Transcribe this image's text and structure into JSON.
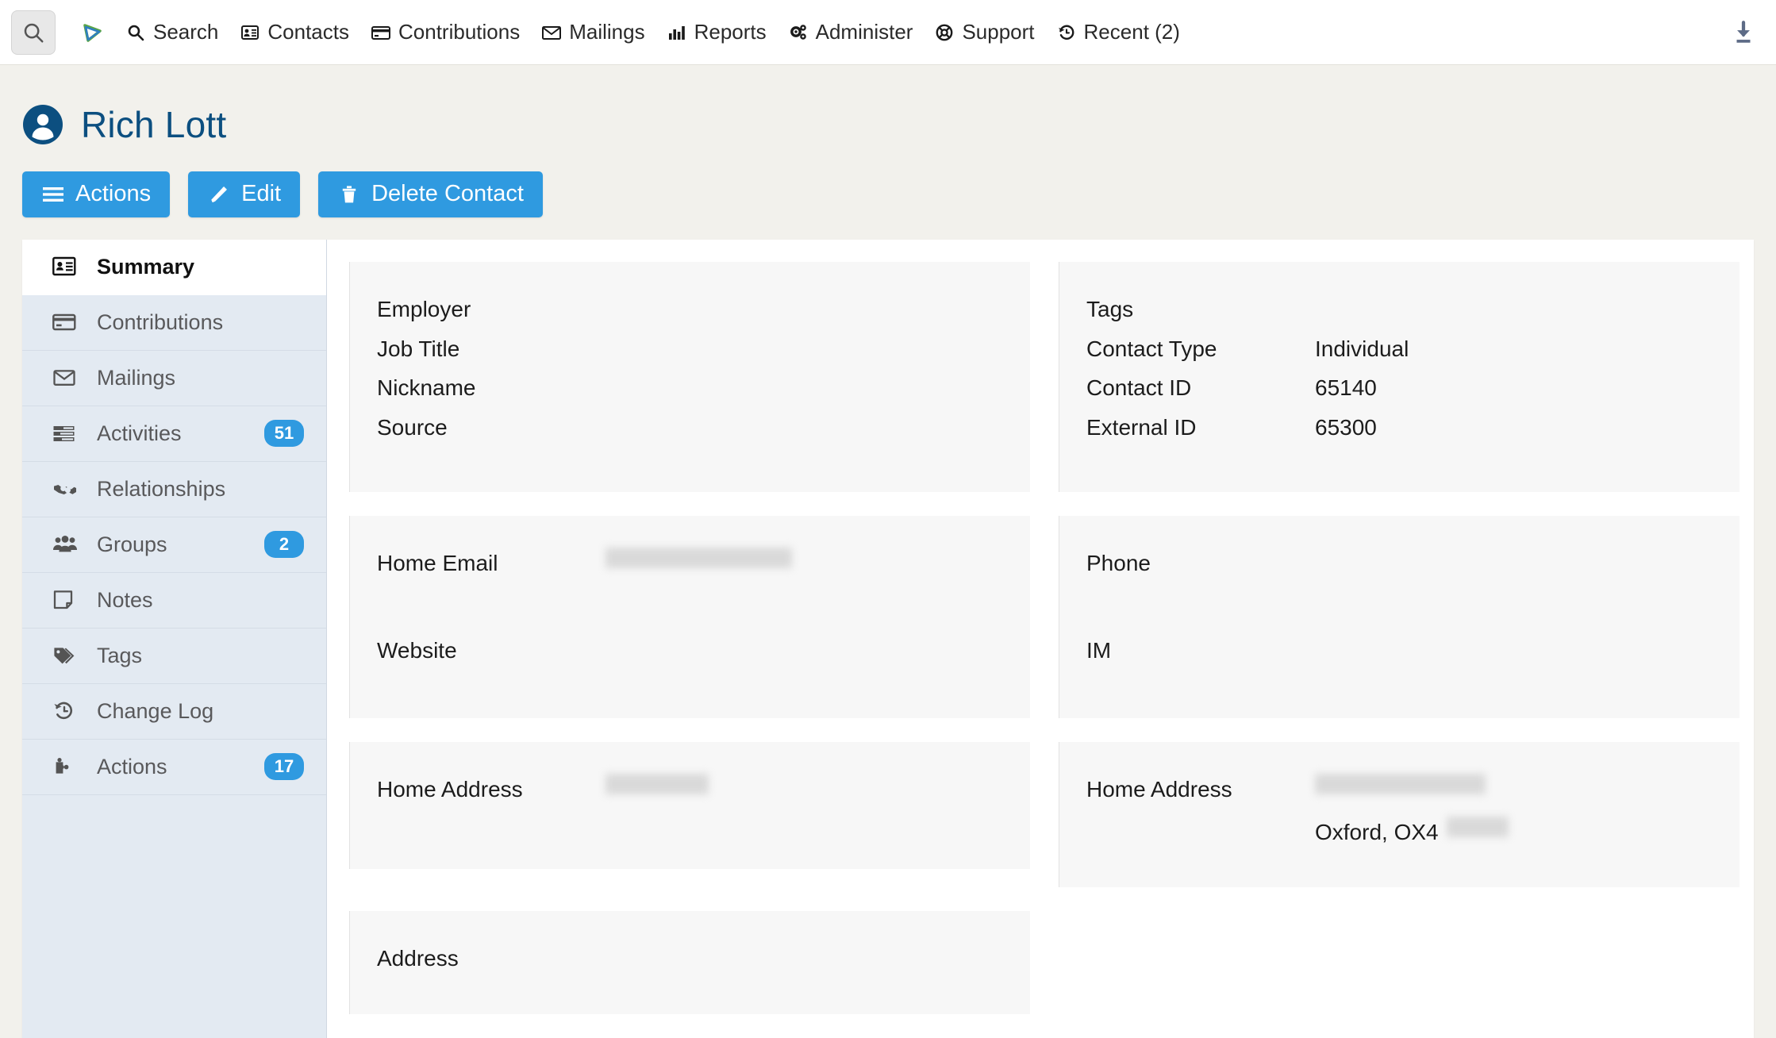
{
  "topnav": {
    "search_button_icon": "search-icon",
    "logo_icon": "civicrm-logo-icon",
    "download_icon": "download-icon",
    "items": [
      {
        "label": "Search",
        "icon": "search-icon"
      },
      {
        "label": "Contacts",
        "icon": "contact-card-icon"
      },
      {
        "label": "Contributions",
        "icon": "credit-card-icon"
      },
      {
        "label": "Mailings",
        "icon": "envelope-icon"
      },
      {
        "label": "Reports",
        "icon": "bar-chart-icon"
      },
      {
        "label": "Administer",
        "icon": "gears-icon"
      },
      {
        "label": "Support",
        "icon": "life-ring-icon"
      },
      {
        "label": "Recent (2)",
        "icon": "history-icon"
      }
    ]
  },
  "contact": {
    "name": "Rich Lott",
    "avatar_icon": "user-circle-icon"
  },
  "actions_bar": [
    {
      "label": "Actions",
      "icon": "hamburger-icon"
    },
    {
      "label": "Edit",
      "icon": "pencil-icon"
    },
    {
      "label": "Delete Contact",
      "icon": "trash-icon"
    }
  ],
  "tabs": [
    {
      "label": "Summary",
      "icon": "contact-card-icon",
      "badge": "",
      "active": true
    },
    {
      "label": "Contributions",
      "icon": "credit-card-icon",
      "badge": "",
      "active": false
    },
    {
      "label": "Mailings",
      "icon": "envelope-icon",
      "badge": "",
      "active": false
    },
    {
      "label": "Activities",
      "icon": "list-icon",
      "badge": "51",
      "active": false
    },
    {
      "label": "Relationships",
      "icon": "handshake-icon",
      "badge": "",
      "active": false
    },
    {
      "label": "Groups",
      "icon": "users-icon",
      "badge": "2",
      "active": false
    },
    {
      "label": "Notes",
      "icon": "note-icon",
      "badge": "",
      "active": false
    },
    {
      "label": "Tags",
      "icon": "tag-icon",
      "badge": "",
      "active": false
    },
    {
      "label": "Change Log",
      "icon": "history-icon",
      "badge": "",
      "active": false
    },
    {
      "label": "Actions",
      "icon": "puzzle-icon",
      "badge": "17",
      "active": false
    }
  ],
  "summary": {
    "employment": {
      "employer_label": "Employer",
      "employer_value": "",
      "job_title_label": "Job Title",
      "job_title_value": "",
      "nickname_label": "Nickname",
      "nickname_value": "",
      "source_label": "Source",
      "source_value": ""
    },
    "contact_meta": {
      "tags_label": "Tags",
      "tags_value": "",
      "contact_type_label": "Contact Type",
      "contact_type_value": "Individual",
      "contact_id_label": "Contact ID",
      "contact_id_value": "65140",
      "external_id_label": "External ID",
      "external_id_value": "65300"
    },
    "email_web": {
      "home_email_label": "Home Email",
      "home_email_value": "",
      "website_label": "Website",
      "website_value": ""
    },
    "phone_im": {
      "phone_label": "Phone",
      "phone_value": "",
      "im_label": "IM",
      "im_value": ""
    },
    "home_address_left": {
      "label": "Home Address",
      "value": ""
    },
    "home_address_right": {
      "label": "Home Address",
      "street_value": "",
      "city_postcode_value": "Oxford, OX4",
      "postcode_suffix_value": ""
    },
    "address": {
      "label": "Address",
      "value": ""
    }
  },
  "colors": {
    "accent_blue": "#2f9ae0",
    "name_blue": "#0c4f80",
    "page_bg": "#f2f1ec",
    "tab_bg": "#e3eaf2",
    "card_bg": "#f7f7f7"
  }
}
